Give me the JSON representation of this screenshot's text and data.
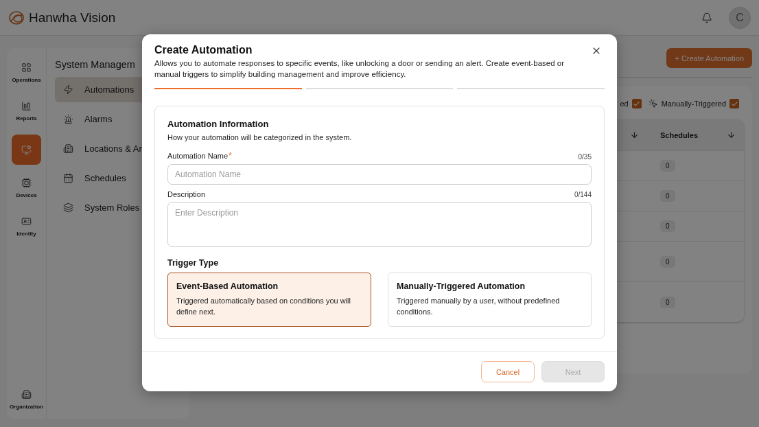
{
  "header": {
    "logo": "Hanwha Vision",
    "avatar": "C"
  },
  "rail": [
    {
      "label": "Operations",
      "selected": false
    },
    {
      "label": "Reports",
      "selected": false
    },
    {
      "selected": true
    },
    {
      "label": "Devices",
      "selected": false
    },
    {
      "label": "Identity",
      "selected": false
    }
  ],
  "rail_bottom": {
    "label": "Organization"
  },
  "subnav": {
    "title": "System Managem",
    "items": [
      {
        "label": "Automations",
        "selected": true
      },
      {
        "label": "Alarms",
        "selected": false
      },
      {
        "label": "Locations & Ar",
        "selected": false
      },
      {
        "label": "Schedules",
        "selected": false
      },
      {
        "label": "System Roles",
        "selected": false
      }
    ]
  },
  "page": {
    "create_button": "+ Create Automation",
    "filters": [
      {
        "label": "ed",
        "checked": true
      },
      {
        "label": "Manually-Triggered",
        "checked": true
      }
    ],
    "table": {
      "column": "Schedules",
      "rows": [
        {
          "schedules": "0"
        },
        {
          "schedules": "0"
        },
        {
          "schedules": "0"
        },
        {
          "schedules": "0"
        },
        {
          "schedules": "0"
        }
      ]
    }
  },
  "modal": {
    "title": "Create Automation",
    "description": "Allows you to automate responses to specific events, like unlocking a door or sending an alert. Create event-based or manual triggers to simplify building management and improve efficiency.",
    "steps": [
      {
        "active": true
      },
      {
        "active": false
      },
      {
        "active": false
      }
    ],
    "section": {
      "title": "Automation Information",
      "subtitle": "How your automation will be categorized in the system.",
      "fields": [
        {
          "kind": "input",
          "label": "Automation Name",
          "required_mark": "*",
          "counter": "0/35",
          "placeholder": "Automation Name"
        },
        {
          "kind": "textarea",
          "label": "Description",
          "counter": "0/144",
          "placeholder": "Enter Description"
        }
      ],
      "trigger_label": "Trigger Type",
      "options": [
        {
          "title": "Event-Based Automation",
          "text": "Triggered automatically based on conditions you will define next.",
          "selected": true
        },
        {
          "title": "Manually-Triggered Automation",
          "text": "Triggered manually by a user, without predefined conditions.",
          "selected": false
        }
      ]
    },
    "buttons": [
      {
        "kind": "secondary",
        "label": "Cancel",
        "disabled": false
      },
      {
        "kind": "primary",
        "label": "Next",
        "disabled": true
      }
    ]
  }
}
